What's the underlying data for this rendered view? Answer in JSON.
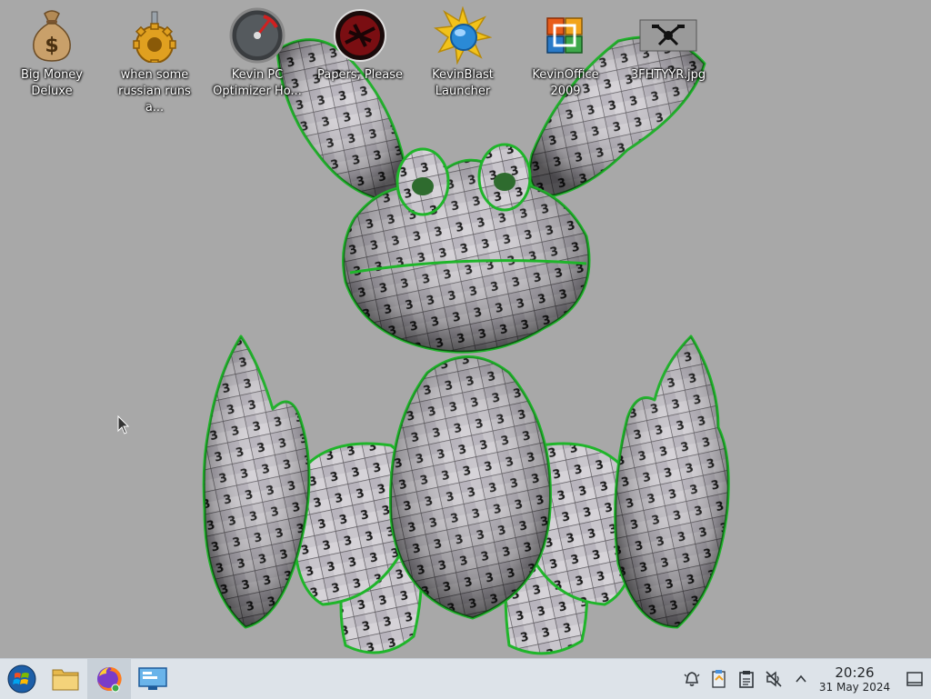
{
  "desktop": {
    "icons": [
      {
        "label": "Big Money Deluxe",
        "icon": "money-bag-icon"
      },
      {
        "label": "when some russian runs a...",
        "icon": "gear-joystick-icon"
      },
      {
        "label": "Kevin PC Optimizer Ho...",
        "icon": "speedometer-icon"
      },
      {
        "label": "Papers, Please",
        "icon": "papers-please-icon"
      },
      {
        "label": "KevinBlast Launcher",
        "icon": "kevinblast-icon"
      },
      {
        "label": "KevinOffice 2009",
        "icon": "office-icon"
      },
      {
        "label": "3FHTYYR.jpg",
        "icon": "image-file-icon"
      }
    ],
    "wallpaper": "checkered-3d-creature"
  },
  "taskbar": {
    "start": {
      "icon": "start-orb-icon"
    },
    "apps": [
      {
        "icon": "file-manager-icon"
      },
      {
        "icon": "firefox-icon",
        "active": true
      },
      {
        "icon": "remote-desktop-icon"
      }
    ],
    "tray": [
      {
        "icon": "notifications-bell-icon"
      },
      {
        "icon": "clipboard-network-icon"
      },
      {
        "icon": "clipboard-icon"
      },
      {
        "icon": "volume-muted-icon"
      },
      {
        "icon": "chevron-up-icon"
      }
    ],
    "clock": {
      "time": "20:26",
      "date": "31 May 2024"
    }
  },
  "colors": {
    "desktop_bg": "#a8a8a8",
    "taskbar_bg": "#dde3e9",
    "outline_green": "#1fb52a"
  }
}
